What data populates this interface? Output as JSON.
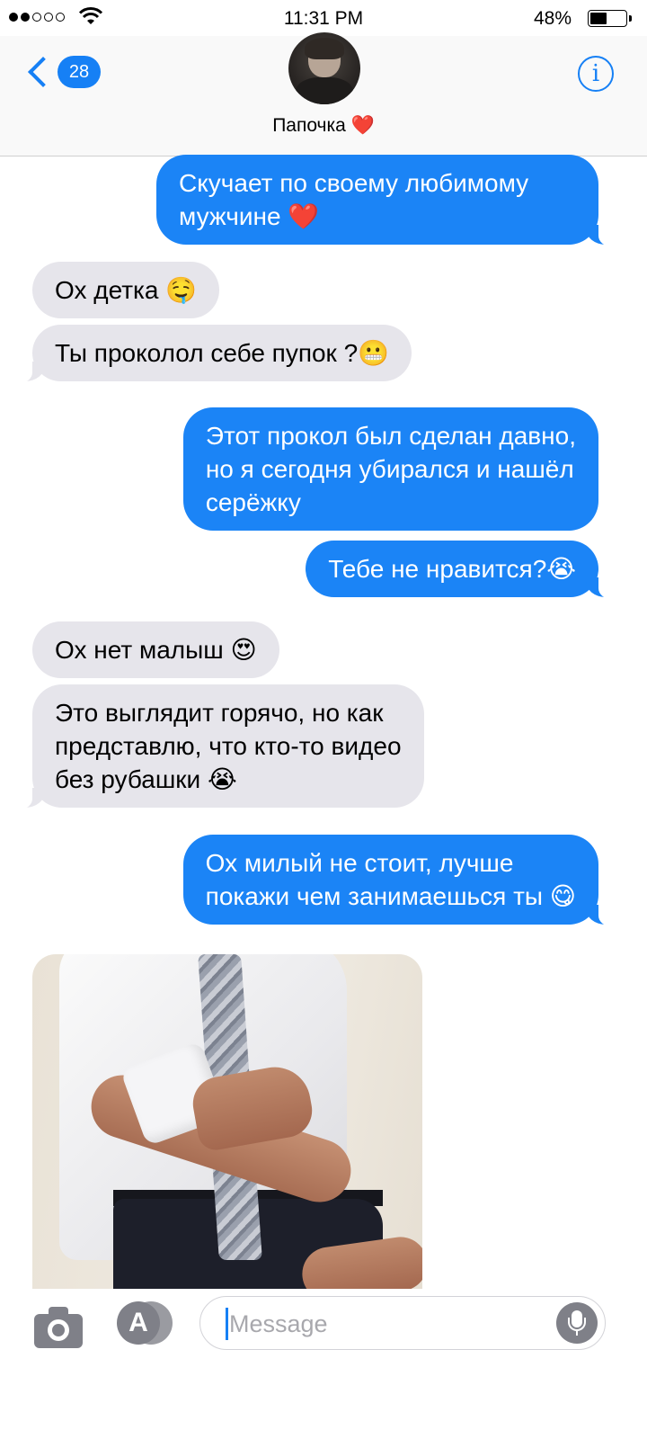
{
  "status_bar": {
    "time": "11:31 PM",
    "battery_percent": "48%",
    "signal_bars_filled": 2,
    "signal_bars_total": 5,
    "battery_level": 0.48
  },
  "header": {
    "unread_count": "28",
    "contact_name": "Папочка ❤️",
    "info_glyph": "i",
    "back_icon": "chevron-left-icon",
    "info_icon": "info-icon"
  },
  "messages": [
    {
      "direction": "outgoing",
      "lines": [
        "Скучает по своему любимому",
        "мужчине ❤️"
      ]
    },
    {
      "direction": "incoming",
      "lines": [
        "Ох детка 🤤"
      ]
    },
    {
      "direction": "incoming",
      "lines": [
        "Ты проколол себе пупок ?😬"
      ]
    },
    {
      "direction": "outgoing",
      "lines": [
        "Этот прокол был сделан давно,",
        "но я сегодня убирался и нашёл",
        "серёжку"
      ]
    },
    {
      "direction": "outgoing",
      "lines": [
        "Тебе не нравится?😭"
      ]
    },
    {
      "direction": "incoming",
      "lines": [
        "Ох нет малыш 😍"
      ]
    },
    {
      "direction": "incoming",
      "lines": [
        "Это выглядит горячо, но как",
        "представлю, что кто-то видео",
        "без рубашки 😭"
      ]
    },
    {
      "direction": "outgoing",
      "lines": [
        "Ох милый не стоит, лучше",
        "покажи чем занимаешься ты 😋"
      ]
    }
  ],
  "input_bar": {
    "placeholder": "Message",
    "value": "",
    "camera_icon": "camera-icon",
    "apps_icon": "app-store-icon",
    "mic_icon": "microphone-icon",
    "apps_glyph": "A"
  },
  "colors": {
    "outgoing_bubble": "#1b84f6",
    "incoming_bubble": "#e6e5eb",
    "accent": "#1680f5"
  }
}
